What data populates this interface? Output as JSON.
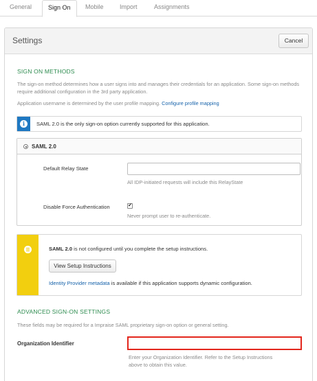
{
  "tabs": [
    "General",
    "Sign On",
    "Mobile",
    "Import",
    "Assignments"
  ],
  "active_tab": "Sign On",
  "panel": {
    "title": "Settings",
    "cancel_label": "Cancel"
  },
  "sign_on_methods": {
    "heading": "SIGN ON METHODS",
    "description": "The sign-on method determines how a user signs into and manages their credentials for an application. Some sign-on methods require additional configuration in the 3rd party application.",
    "username_text": "Application username is determined by the user profile mapping.",
    "configure_link": "Configure profile mapping"
  },
  "info_banner": {
    "icon": "info-icon",
    "text": "SAML 2.0 is the only sign-on option currently supported for this application.",
    "color": "#1e78c2"
  },
  "saml": {
    "option_label": "SAML 2.0",
    "relay_state_label": "Default Relay State",
    "relay_state_value": "",
    "relay_state_hint": "All IDP-initiated requests will include this RelayState",
    "force_auth_label": "Disable Force Authentication",
    "force_auth_checked": true,
    "force_auth_check_glyph": "✔",
    "force_auth_hint": "Never prompt user to re-authenticate."
  },
  "setup_notice": {
    "icon": "list-icon",
    "bold": "SAML 2.0",
    "text": " is not configured until you complete the setup instructions.",
    "button_label": "View Setup Instructions",
    "metadata_link": "Identity Provider metadata",
    "metadata_text": " is available if this application supports dynamic configuration.",
    "color": "#f2cf0f"
  },
  "advanced": {
    "heading": "ADVANCED SIGN-ON SETTINGS",
    "description": "These fields may be required for a Impraise SAML proprietary sign-on option or general setting.",
    "org_label": "Organization Identifier",
    "org_value": "",
    "org_hint_1": "Enter your Organization Identifier. Refer to the Setup Instructions",
    "org_hint_2": "above to obtain this value.",
    "highlight_color": "#e3261c"
  }
}
